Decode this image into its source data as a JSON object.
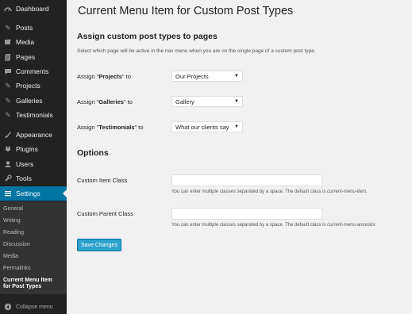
{
  "sidebar": {
    "items": [
      {
        "label": "Dashboard",
        "icon": "dashboard-icon"
      },
      {
        "label": "Posts",
        "icon": "pin-icon"
      },
      {
        "label": "Media",
        "icon": "media-icon"
      },
      {
        "label": "Pages",
        "icon": "pages-icon"
      },
      {
        "label": "Comments",
        "icon": "comments-icon"
      },
      {
        "label": "Projects",
        "icon": "pin-icon"
      },
      {
        "label": "Galleries",
        "icon": "pin-icon"
      },
      {
        "label": "Testimonials",
        "icon": "pin-icon"
      },
      {
        "label": "Appearance",
        "icon": "brush-icon"
      },
      {
        "label": "Plugins",
        "icon": "plug-icon"
      },
      {
        "label": "Users",
        "icon": "user-icon"
      },
      {
        "label": "Tools",
        "icon": "wrench-icon"
      },
      {
        "label": "Settings",
        "icon": "settings-icon"
      }
    ],
    "submenu": [
      "General",
      "Writing",
      "Reading",
      "Discussion",
      "Media",
      "Permalinks",
      "Current Menu Item for Post Types"
    ],
    "collapse_label": "Collapse menu"
  },
  "main": {
    "title": "Current Menu Item for Custom Post Types",
    "section1": {
      "title": "Assign custom post types to pages",
      "description": "Select which page will be active in the nav menu when you are on the single page of a custom post type.",
      "rows": [
        {
          "prefix": "Assign \"",
          "name": "Projects",
          "suffix": "\" to",
          "selected": "Our Projects"
        },
        {
          "prefix": "Assign \"",
          "name": "Galleries",
          "suffix": "\" to",
          "selected": "Gallery"
        },
        {
          "prefix": "Assign \"",
          "name": "Testimonials",
          "suffix": "\" to",
          "selected": "What our clients say"
        }
      ]
    },
    "section2": {
      "title": "Options",
      "fields": [
        {
          "label": "Custom Item Class",
          "value": "",
          "hint": "You can enter multiple classes separated by a space. The default class is ",
          "hint_class": "current-menu-item."
        },
        {
          "label": "Custom Parent Class",
          "value": "",
          "hint": "You can enter multiple classes separated by a space. The default class is ",
          "hint_class": "current-menu-ancestor."
        }
      ]
    },
    "save_label": "Save Changes"
  },
  "colors": {
    "sidebar_bg": "#222222",
    "active_bg": "#0074a2",
    "button_bg": "#2ea2cc",
    "page_bg": "#f1f1f1"
  }
}
